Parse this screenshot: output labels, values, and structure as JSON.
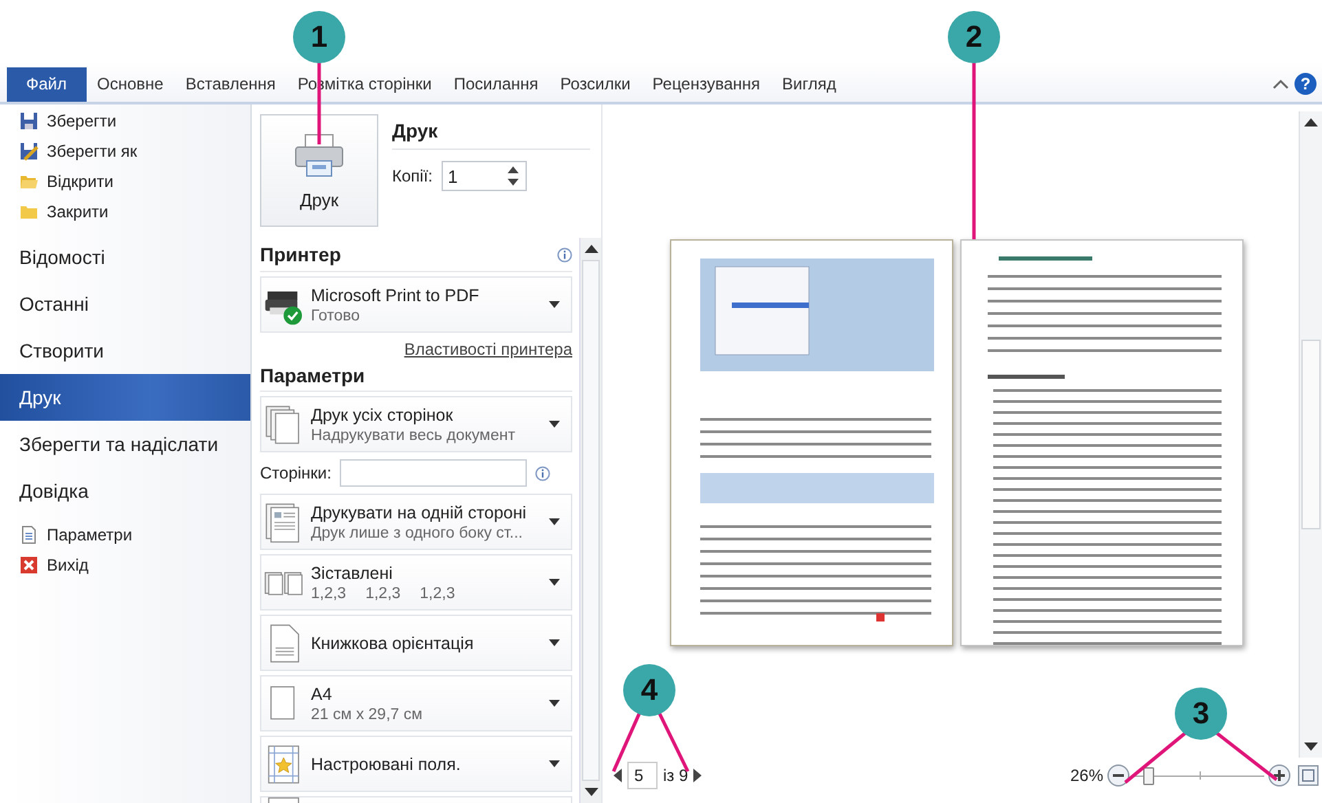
{
  "callouts": [
    {
      "number": "1"
    },
    {
      "number": "2"
    },
    {
      "number": "3"
    },
    {
      "number": "4"
    }
  ],
  "ribbon": {
    "tabs": [
      {
        "label": "Файл",
        "selected": true
      },
      {
        "label": "Основне",
        "selected": false
      },
      {
        "label": "Вставлення",
        "selected": false
      },
      {
        "label": "Розмітка сторінки",
        "selected": false
      },
      {
        "label": "Посилання",
        "selected": false
      },
      {
        "label": "Розсилки",
        "selected": false
      },
      {
        "label": "Рецензування",
        "selected": false
      },
      {
        "label": "Вигляд",
        "selected": false
      }
    ],
    "help": "?"
  },
  "menu": {
    "items": [
      {
        "label": "Зберегти",
        "kind": "save"
      },
      {
        "label": "Зберегти як",
        "kind": "saveas"
      },
      {
        "label": "Відкрити",
        "kind": "open"
      },
      {
        "label": "Закрити",
        "kind": "close"
      },
      {
        "label": "Відомості",
        "kind": "section",
        "selected": false
      },
      {
        "label": "Останні",
        "kind": "section",
        "selected": false
      },
      {
        "label": "Створити",
        "kind": "section",
        "selected": false
      },
      {
        "label": "Друк",
        "kind": "section",
        "selected": true
      },
      {
        "label": "Зберегти та надіслати",
        "kind": "section",
        "selected": false
      },
      {
        "label": "Довідка",
        "kind": "section",
        "selected": false
      },
      {
        "label": "Параметри",
        "kind": "options"
      },
      {
        "label": "Вихід",
        "kind": "exit"
      }
    ]
  },
  "print": {
    "button": "Друк",
    "title": "Друк",
    "copies_label": "Копії:",
    "copies": "1"
  },
  "printer": {
    "heading": "Принтер",
    "name": "Microsoft Print to PDF",
    "status": "Готово",
    "properties_link": "Властивості принтера"
  },
  "settings": {
    "heading": "Параметри",
    "pages_label": "Сторінки:",
    "options": [
      {
        "kind": "pages",
        "title": "Друк усіх сторінок",
        "subtitle": "Надрукувати весь документ"
      },
      {
        "kind": "sides",
        "title": "Друкувати на одній стороні",
        "subtitle": "Друк лише з одного боку ст..."
      },
      {
        "kind": "collate",
        "title": "Зіставлені",
        "collation": [
          "1,2,3",
          "1,2,3",
          "1,2,3"
        ]
      },
      {
        "kind": "orientation",
        "title": "Книжкова орієнтація"
      },
      {
        "kind": "paper",
        "title": "A4",
        "subtitle": "21 см x 29,7 см"
      },
      {
        "kind": "margins",
        "title": "Настроювані поля."
      }
    ]
  },
  "preview": {
    "page_number": "5",
    "of_label": "із 9",
    "zoom": "26%",
    "zoom_slider": {
      "level": 0.1
    }
  }
}
